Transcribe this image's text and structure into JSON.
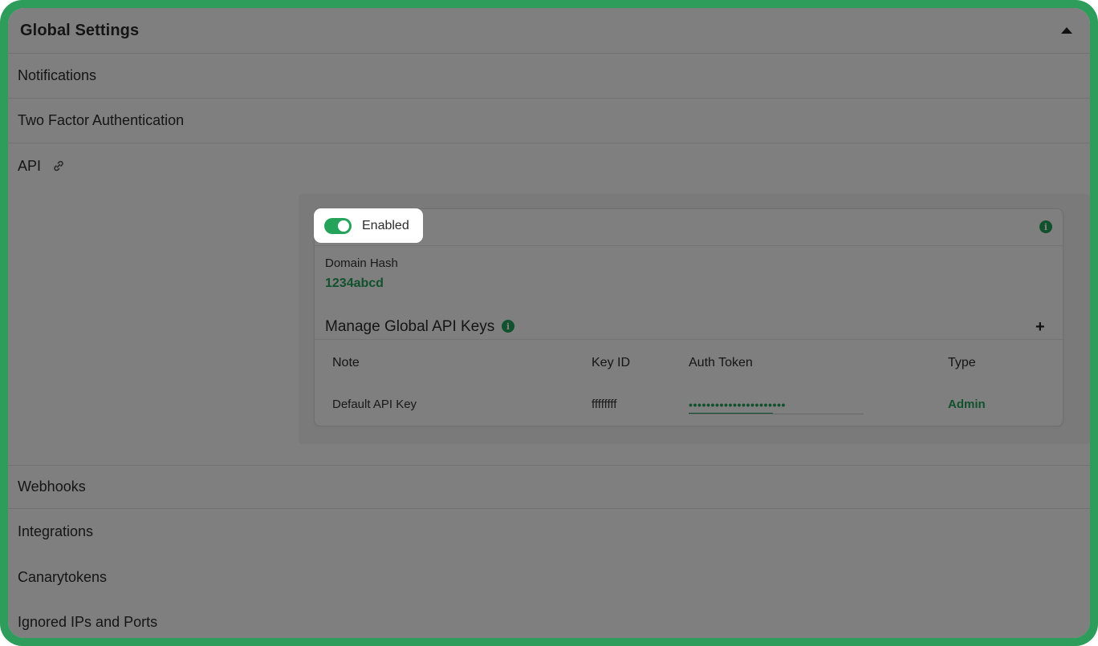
{
  "header": {
    "title": "Global Settings"
  },
  "sections": {
    "notifications": "Notifications",
    "two_factor": "Two Factor Authentication",
    "api": "API",
    "webhooks": "Webhooks",
    "integrations": "Integrations",
    "canarytokens": "Canarytokens",
    "ignored": "Ignored IPs and Ports"
  },
  "api": {
    "toggle_label": "Enabled",
    "toggle_on": true,
    "domain_hash_label": "Domain Hash",
    "domain_hash_value": "1234abcd",
    "manage_keys_title": "Manage Global API Keys",
    "table": {
      "headers": [
        "Note",
        "Key ID",
        "Auth Token",
        "Type"
      ],
      "rows": [
        {
          "note": "Default API Key",
          "key_id": "ffffffff",
          "auth_token": "••••••••••••••••••••••",
          "type": "Admin"
        }
      ]
    }
  },
  "colors": {
    "accent": "#25a35a",
    "frame": "#2e9c5a"
  },
  "icons": {
    "collapse": "caret-up-icon",
    "link": "link-icon",
    "info": "info-icon",
    "add": "plus-icon"
  }
}
